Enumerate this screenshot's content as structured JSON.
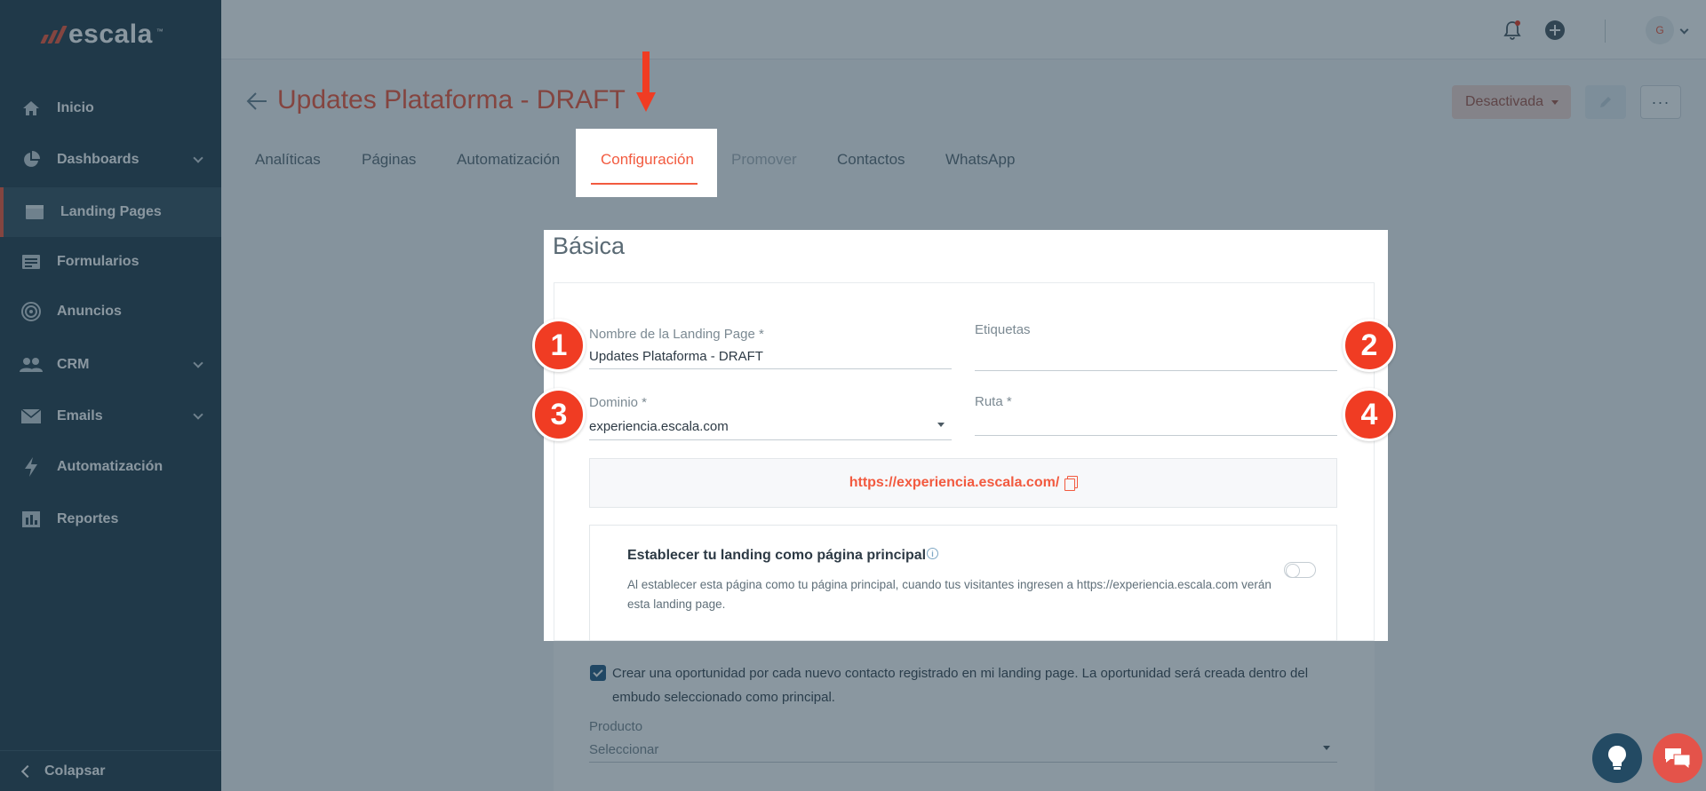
{
  "app": {
    "logo_text": "escala",
    "logo_tm": "™"
  },
  "sidebar": {
    "items": [
      {
        "label": "Inicio",
        "icon": "home-icon"
      },
      {
        "label": "Dashboards",
        "icon": "pie-chart-icon"
      },
      {
        "label": "Landing Pages",
        "icon": "browser-window-icon"
      },
      {
        "label": "Formularios",
        "icon": "form-icon"
      },
      {
        "label": "Anuncios",
        "icon": "target-icon"
      },
      {
        "label": "CRM",
        "icon": "users-icon"
      },
      {
        "label": "Emails",
        "icon": "envelope-icon"
      },
      {
        "label": "Automatización",
        "icon": "lightning-icon"
      },
      {
        "label": "Reportes",
        "icon": "report-icon"
      }
    ],
    "collapse_label": "Colapsar"
  },
  "topbar": {
    "avatar_initial": "G"
  },
  "header": {
    "title": "Updates Plataforma - DRAFT",
    "status_label": "Desactivada",
    "more_label": "···"
  },
  "tabs": [
    {
      "label": "Analíticas"
    },
    {
      "label": "Páginas"
    },
    {
      "label": "Automatización"
    },
    {
      "label": "Configuración"
    },
    {
      "label": "Promover"
    },
    {
      "label": "Contactos"
    },
    {
      "label": "WhatsApp"
    }
  ],
  "form": {
    "section_title": "Básica",
    "name_label": "Nombre de la Landing Page *",
    "name_value": "Updates Plataforma - DRAFT",
    "tags_label": "Etiquetas",
    "domain_label": "Dominio *",
    "domain_value": "experiencia.escala.com",
    "path_label": "Ruta *",
    "url": "https://experiencia.escala.com/",
    "main_page_title": "Establecer tu landing como página principal",
    "main_page_desc": "Al establecer esta página como tu página principal, cuando tus visitantes ingresen a https://experiencia.escala.com verán esta landing page.",
    "info_glyph": "i",
    "opportunity_text": "Crear una oportunidad por cada nuevo contacto registrado en mi landing page. La oportunidad será creada dentro del embudo seleccionado como principal.",
    "product_label": "Producto",
    "product_value": "Seleccionar"
  },
  "badges": [
    "1",
    "2",
    "3",
    "4"
  ],
  "colors": {
    "accent": "#f25a3f",
    "sidebar": "#2b4350",
    "badge": "#f03c23"
  }
}
